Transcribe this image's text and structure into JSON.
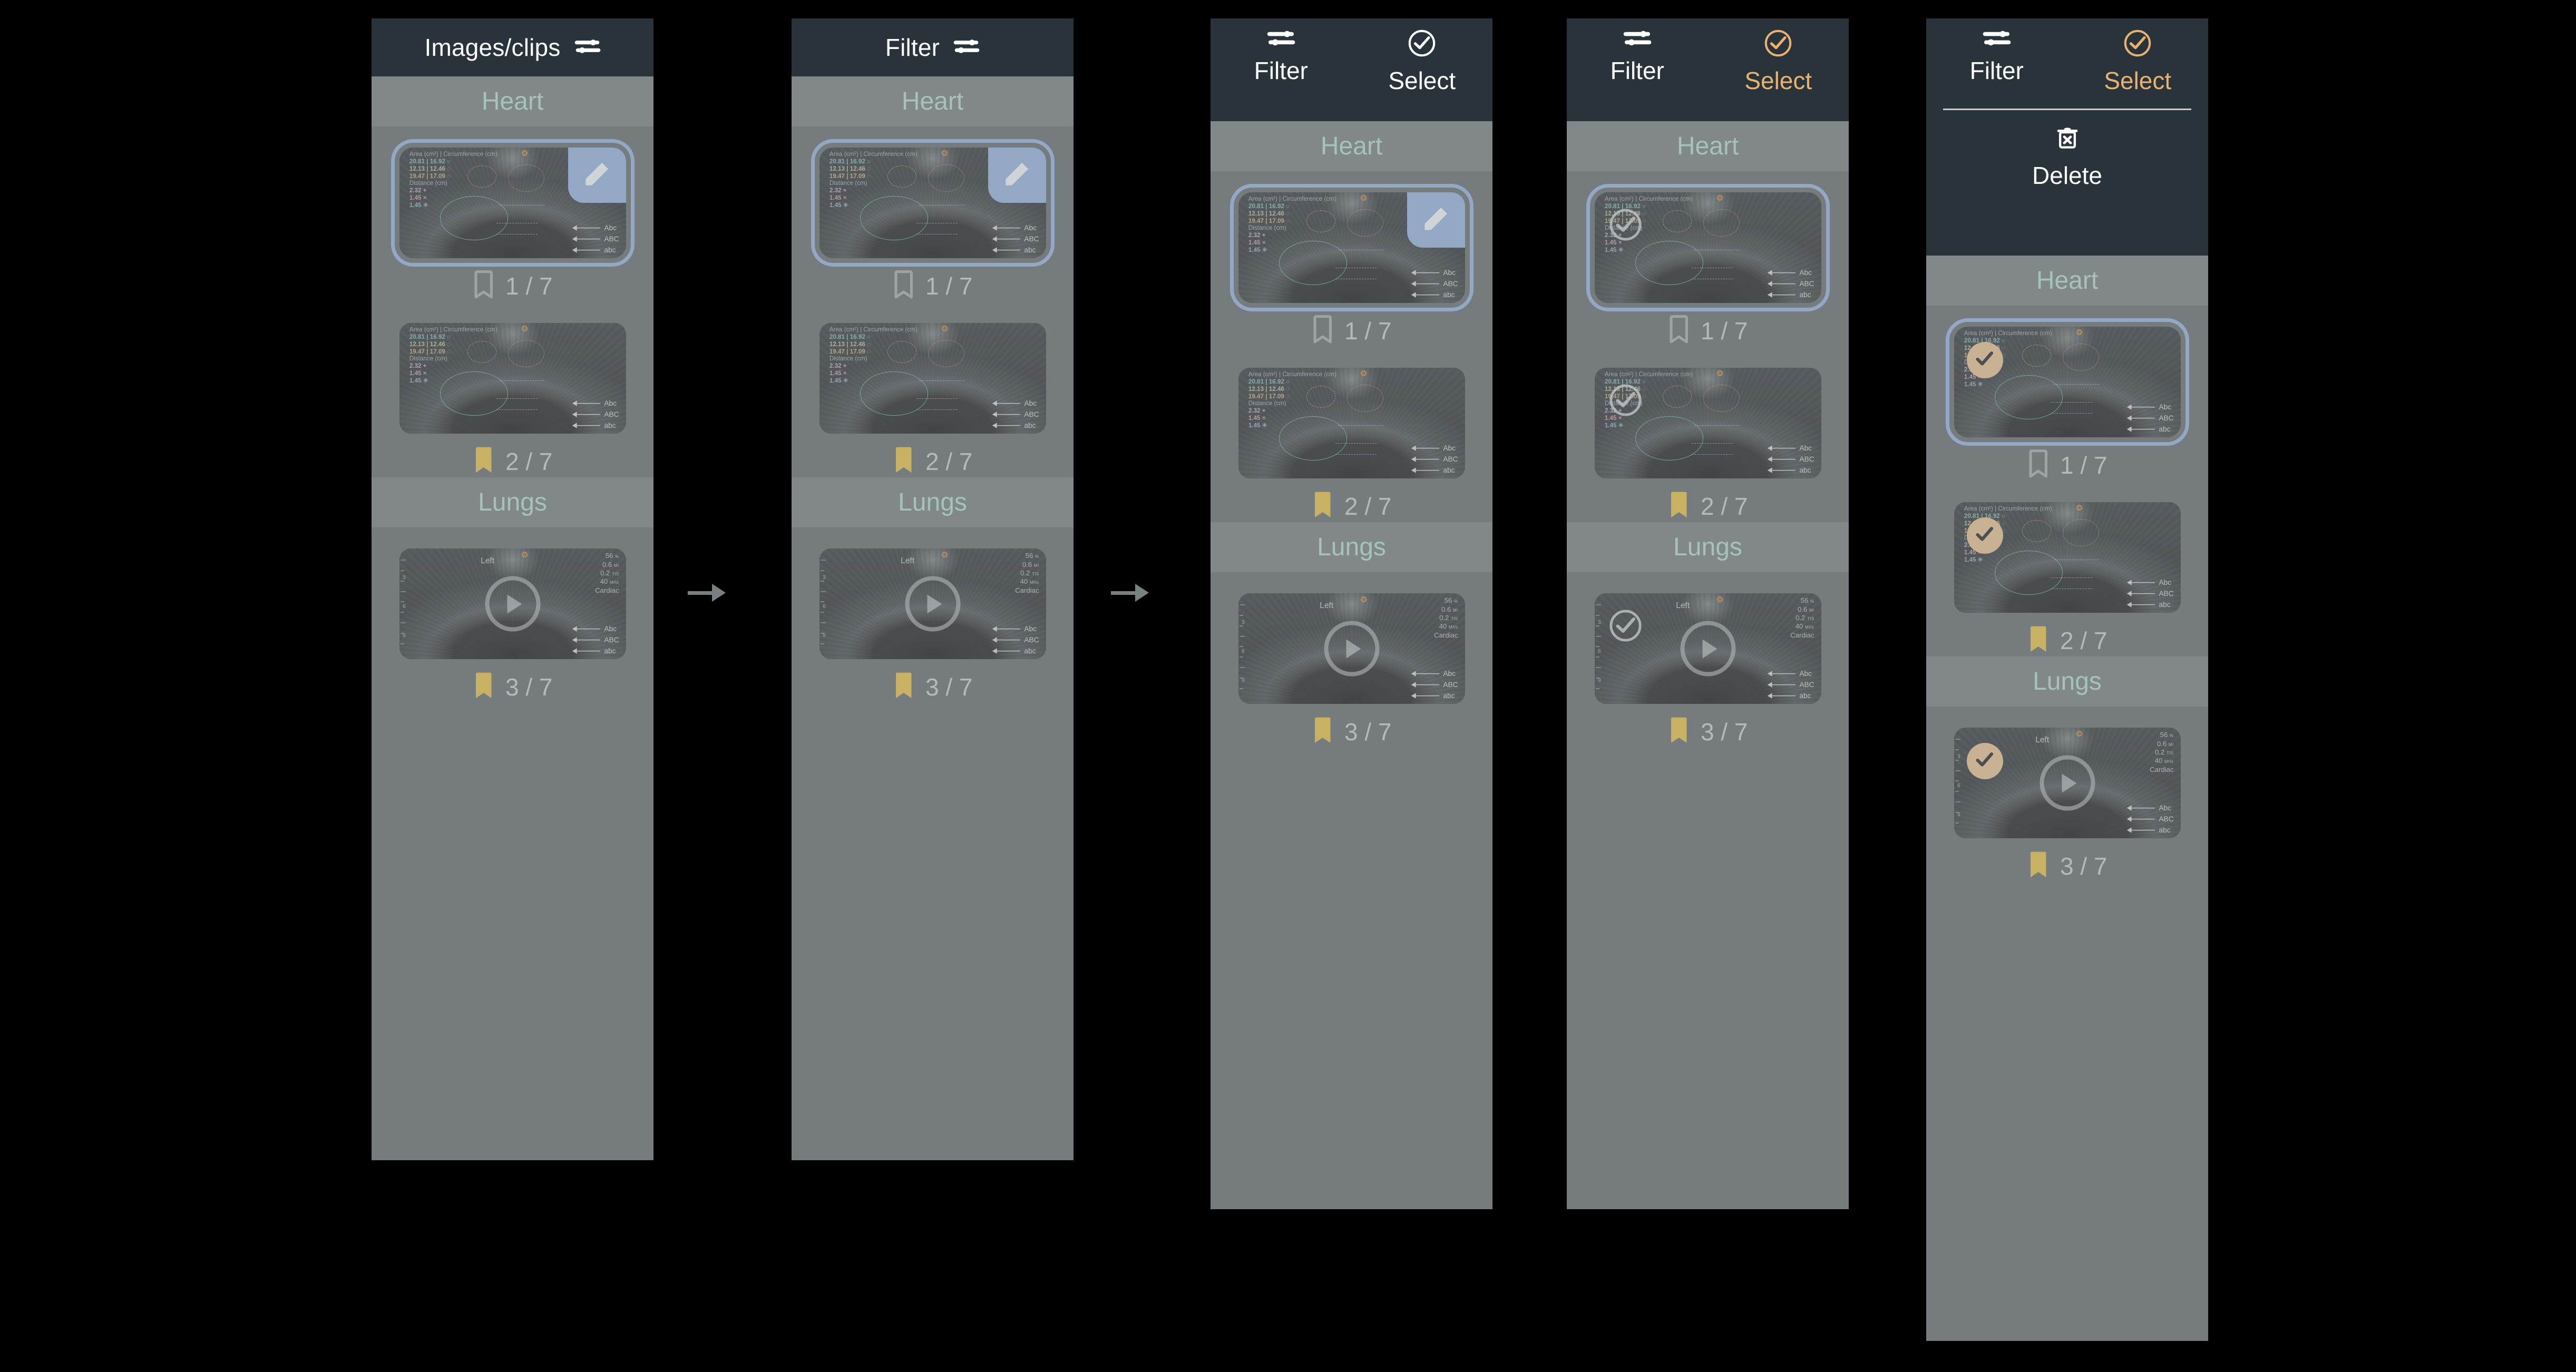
{
  "meta": {
    "accent_orange": "#e8b273",
    "accent_tan": "#c9b294",
    "bookmark_filled": "#c9b163",
    "panel_bg": "#767b7e",
    "header_bg": "#28343a",
    "section_band_bg": "#82878a",
    "section_title_color": "#a5c2bd",
    "select_outline": "#93a8c4"
  },
  "panels": [
    {
      "id": "panel-1",
      "header": {
        "type": "title",
        "title": "Images/clips",
        "icon": "sliders-icon"
      },
      "sections": [
        {
          "title": "Heart",
          "items": [
            {
              "kind": "image",
              "selected": true,
              "edit_badge": true,
              "check": "none",
              "bookmark": "outline",
              "count": "1 / 7"
            },
            {
              "kind": "image",
              "selected": false,
              "edit_badge": false,
              "check": "none",
              "bookmark": "filled",
              "count": "2 / 7"
            }
          ]
        },
        {
          "title": "Lungs",
          "items": [
            {
              "kind": "clip",
              "selected": false,
              "edit_badge": false,
              "check": "none",
              "bookmark": "filled",
              "count": "3 / 7"
            }
          ]
        }
      ]
    },
    {
      "id": "panel-2",
      "header": {
        "type": "title",
        "title": "Filter",
        "icon": "sliders-icon"
      },
      "sections": [
        {
          "title": "Heart",
          "items": [
            {
              "kind": "image",
              "selected": true,
              "edit_badge": true,
              "check": "none",
              "bookmark": "outline",
              "count": "1 / 7"
            },
            {
              "kind": "image",
              "selected": false,
              "edit_badge": false,
              "check": "none",
              "bookmark": "filled",
              "count": "2 / 7"
            }
          ]
        },
        {
          "title": "Lungs",
          "items": [
            {
              "kind": "clip",
              "selected": false,
              "edit_badge": false,
              "check": "none",
              "bookmark": "filled",
              "count": "3 / 7"
            }
          ]
        }
      ]
    },
    {
      "id": "panel-3",
      "header": {
        "type": "actions",
        "actions": [
          {
            "label": "Filter",
            "icon": "sliders-icon",
            "active": false
          },
          {
            "label": "Select",
            "icon": "check-circle-icon",
            "active": false
          }
        ]
      },
      "sections": [
        {
          "title": "Heart",
          "items": [
            {
              "kind": "image",
              "selected": true,
              "edit_badge": true,
              "check": "none",
              "bookmark": "outline",
              "count": "1 / 7"
            },
            {
              "kind": "image",
              "selected": false,
              "edit_badge": false,
              "check": "none",
              "bookmark": "filled",
              "count": "2 / 7"
            }
          ]
        },
        {
          "title": "Lungs",
          "items": [
            {
              "kind": "clip",
              "selected": false,
              "edit_badge": false,
              "check": "none",
              "bookmark": "filled",
              "count": "3 / 7"
            }
          ]
        }
      ]
    },
    {
      "id": "panel-4",
      "header": {
        "type": "actions",
        "actions": [
          {
            "label": "Filter",
            "icon": "sliders-icon",
            "active": false
          },
          {
            "label": "Select",
            "icon": "check-circle-icon",
            "active": true
          }
        ]
      },
      "sections": [
        {
          "title": "Heart",
          "items": [
            {
              "kind": "image",
              "selected": true,
              "edit_badge": false,
              "check": "off",
              "bookmark": "outline",
              "count": "1 / 7"
            },
            {
              "kind": "image",
              "selected": false,
              "edit_badge": false,
              "check": "off",
              "bookmark": "filled",
              "count": "2 / 7"
            }
          ]
        },
        {
          "title": "Lungs",
          "items": [
            {
              "kind": "clip",
              "selected": false,
              "edit_badge": false,
              "check": "off",
              "bookmark": "filled",
              "count": "3 / 7"
            }
          ]
        }
      ]
    },
    {
      "id": "panel-5",
      "header": {
        "type": "actions-delete",
        "actions": [
          {
            "label": "Filter",
            "icon": "sliders-icon",
            "active": false
          },
          {
            "label": "Select",
            "icon": "check-circle-icon",
            "active": true
          }
        ],
        "delete": {
          "label": "Delete",
          "icon": "trash-x-icon"
        }
      },
      "sections": [
        {
          "title": "Heart",
          "items": [
            {
              "kind": "image",
              "selected": true,
              "edit_badge": false,
              "check": "on",
              "bookmark": "outline",
              "count": "1 / 7"
            },
            {
              "kind": "image",
              "selected": false,
              "edit_badge": false,
              "check": "on",
              "bookmark": "filled",
              "count": "2 / 7"
            }
          ]
        },
        {
          "title": "Lungs",
          "items": [
            {
              "kind": "clip",
              "selected": false,
              "edit_badge": false,
              "check": "on",
              "bookmark": "filled",
              "count": "3 / 7"
            }
          ]
        }
      ]
    }
  ],
  "image_overlay": {
    "header": "Area (cm²) | Circumference (cm)",
    "area_rows": [
      {
        "area": "20.81",
        "circ": "16.92",
        "marker": "circle-solid"
      },
      {
        "area": "12.13",
        "circ": "12.46",
        "marker": "circle-dotted"
      },
      {
        "area": "19.47",
        "circ": "17.09",
        "marker": "circle-dashed"
      }
    ],
    "distance_header": "Distance (cm)",
    "distance_rows": [
      {
        "value": "2.32",
        "symbol": "+"
      },
      {
        "value": "1.45",
        "symbol": "×"
      },
      {
        "value": "1.45",
        "symbol": "✳"
      }
    ],
    "annotations": [
      "Abc",
      "ABC",
      "abc"
    ]
  },
  "clip_overlay": {
    "side_label": "Left",
    "stats": [
      {
        "value": "56",
        "unit": "%"
      },
      {
        "value": "0.6",
        "unit": "MI"
      },
      {
        "value": "0.2",
        "unit": "TIS"
      },
      {
        "value": "40",
        "unit": "MHz"
      }
    ],
    "preset": "Cardiac",
    "depth_ticks": [
      "3",
      "6",
      "9"
    ],
    "annotations": [
      "Abc",
      "ABC",
      "abc"
    ]
  },
  "flow_arrows": [
    {
      "id": "flow-arrow-1"
    },
    {
      "id": "flow-arrow-2"
    }
  ]
}
